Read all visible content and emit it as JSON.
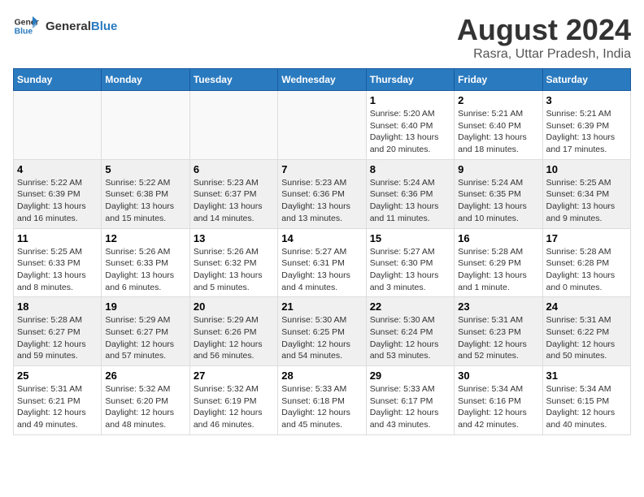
{
  "header": {
    "logo_line1": "General",
    "logo_line2": "Blue",
    "title": "August 2024",
    "subtitle": "Rasra, Uttar Pradesh, India"
  },
  "calendar": {
    "days_of_week": [
      "Sunday",
      "Monday",
      "Tuesday",
      "Wednesday",
      "Thursday",
      "Friday",
      "Saturday"
    ],
    "weeks": [
      [
        {
          "day": "",
          "info": ""
        },
        {
          "day": "",
          "info": ""
        },
        {
          "day": "",
          "info": ""
        },
        {
          "day": "",
          "info": ""
        },
        {
          "day": "1",
          "info": "Sunrise: 5:20 AM\nSunset: 6:40 PM\nDaylight: 13 hours\nand 20 minutes."
        },
        {
          "day": "2",
          "info": "Sunrise: 5:21 AM\nSunset: 6:40 PM\nDaylight: 13 hours\nand 18 minutes."
        },
        {
          "day": "3",
          "info": "Sunrise: 5:21 AM\nSunset: 6:39 PM\nDaylight: 13 hours\nand 17 minutes."
        }
      ],
      [
        {
          "day": "4",
          "info": "Sunrise: 5:22 AM\nSunset: 6:39 PM\nDaylight: 13 hours\nand 16 minutes."
        },
        {
          "day": "5",
          "info": "Sunrise: 5:22 AM\nSunset: 6:38 PM\nDaylight: 13 hours\nand 15 minutes."
        },
        {
          "day": "6",
          "info": "Sunrise: 5:23 AM\nSunset: 6:37 PM\nDaylight: 13 hours\nand 14 minutes."
        },
        {
          "day": "7",
          "info": "Sunrise: 5:23 AM\nSunset: 6:36 PM\nDaylight: 13 hours\nand 13 minutes."
        },
        {
          "day": "8",
          "info": "Sunrise: 5:24 AM\nSunset: 6:36 PM\nDaylight: 13 hours\nand 11 minutes."
        },
        {
          "day": "9",
          "info": "Sunrise: 5:24 AM\nSunset: 6:35 PM\nDaylight: 13 hours\nand 10 minutes."
        },
        {
          "day": "10",
          "info": "Sunrise: 5:25 AM\nSunset: 6:34 PM\nDaylight: 13 hours\nand 9 minutes."
        }
      ],
      [
        {
          "day": "11",
          "info": "Sunrise: 5:25 AM\nSunset: 6:33 PM\nDaylight: 13 hours\nand 8 minutes."
        },
        {
          "day": "12",
          "info": "Sunrise: 5:26 AM\nSunset: 6:33 PM\nDaylight: 13 hours\nand 6 minutes."
        },
        {
          "day": "13",
          "info": "Sunrise: 5:26 AM\nSunset: 6:32 PM\nDaylight: 13 hours\nand 5 minutes."
        },
        {
          "day": "14",
          "info": "Sunrise: 5:27 AM\nSunset: 6:31 PM\nDaylight: 13 hours\nand 4 minutes."
        },
        {
          "day": "15",
          "info": "Sunrise: 5:27 AM\nSunset: 6:30 PM\nDaylight: 13 hours\nand 3 minutes."
        },
        {
          "day": "16",
          "info": "Sunrise: 5:28 AM\nSunset: 6:29 PM\nDaylight: 13 hours\nand 1 minute."
        },
        {
          "day": "17",
          "info": "Sunrise: 5:28 AM\nSunset: 6:28 PM\nDaylight: 13 hours\nand 0 minutes."
        }
      ],
      [
        {
          "day": "18",
          "info": "Sunrise: 5:28 AM\nSunset: 6:27 PM\nDaylight: 12 hours\nand 59 minutes."
        },
        {
          "day": "19",
          "info": "Sunrise: 5:29 AM\nSunset: 6:27 PM\nDaylight: 12 hours\nand 57 minutes."
        },
        {
          "day": "20",
          "info": "Sunrise: 5:29 AM\nSunset: 6:26 PM\nDaylight: 12 hours\nand 56 minutes."
        },
        {
          "day": "21",
          "info": "Sunrise: 5:30 AM\nSunset: 6:25 PM\nDaylight: 12 hours\nand 54 minutes."
        },
        {
          "day": "22",
          "info": "Sunrise: 5:30 AM\nSunset: 6:24 PM\nDaylight: 12 hours\nand 53 minutes."
        },
        {
          "day": "23",
          "info": "Sunrise: 5:31 AM\nSunset: 6:23 PM\nDaylight: 12 hours\nand 52 minutes."
        },
        {
          "day": "24",
          "info": "Sunrise: 5:31 AM\nSunset: 6:22 PM\nDaylight: 12 hours\nand 50 minutes."
        }
      ],
      [
        {
          "day": "25",
          "info": "Sunrise: 5:31 AM\nSunset: 6:21 PM\nDaylight: 12 hours\nand 49 minutes."
        },
        {
          "day": "26",
          "info": "Sunrise: 5:32 AM\nSunset: 6:20 PM\nDaylight: 12 hours\nand 48 minutes."
        },
        {
          "day": "27",
          "info": "Sunrise: 5:32 AM\nSunset: 6:19 PM\nDaylight: 12 hours\nand 46 minutes."
        },
        {
          "day": "28",
          "info": "Sunrise: 5:33 AM\nSunset: 6:18 PM\nDaylight: 12 hours\nand 45 minutes."
        },
        {
          "day": "29",
          "info": "Sunrise: 5:33 AM\nSunset: 6:17 PM\nDaylight: 12 hours\nand 43 minutes."
        },
        {
          "day": "30",
          "info": "Sunrise: 5:34 AM\nSunset: 6:16 PM\nDaylight: 12 hours\nand 42 minutes."
        },
        {
          "day": "31",
          "info": "Sunrise: 5:34 AM\nSunset: 6:15 PM\nDaylight: 12 hours\nand 40 minutes."
        }
      ]
    ]
  }
}
